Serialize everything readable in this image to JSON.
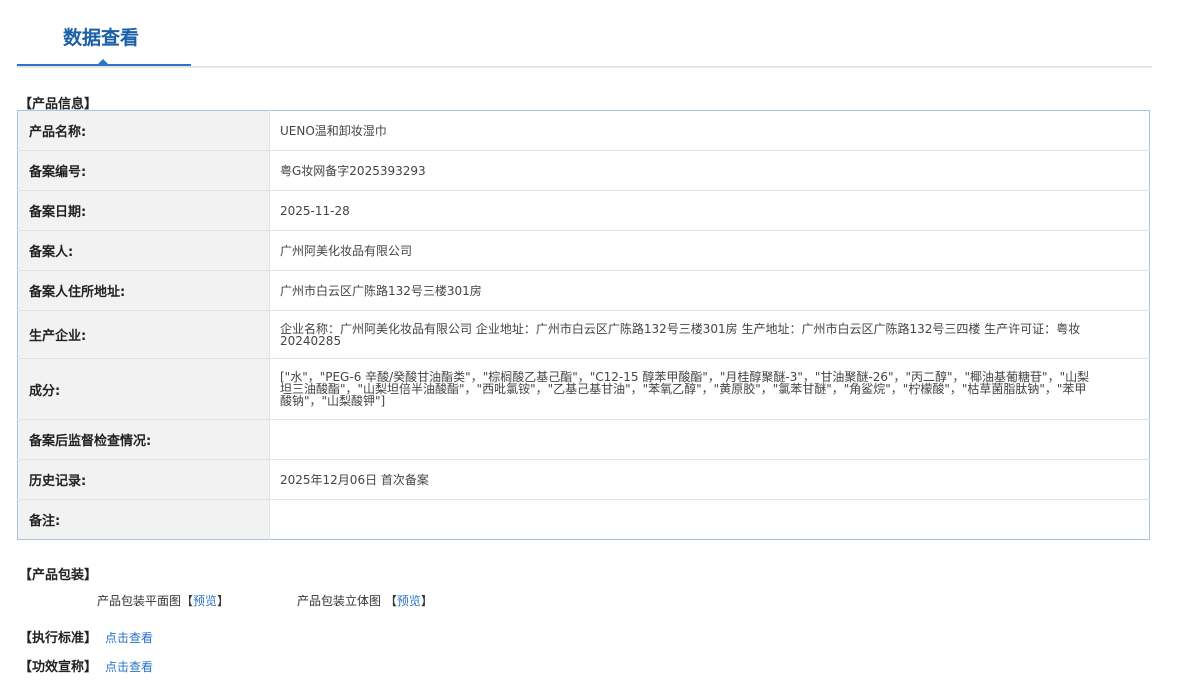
{
  "tab": {
    "title": "数据查看"
  },
  "product_info": {
    "section_title": "【产品信息】",
    "rows": [
      {
        "label": "产品名称:",
        "value": "UENO温和卸妆湿巾"
      },
      {
        "label": "备案编号:",
        "value": "粤G妆网备字2025393293"
      },
      {
        "label": "备案日期:",
        "value": "2025-11-28"
      },
      {
        "label": "备案人:",
        "value": "广州阿美化妆品有限公司"
      },
      {
        "label": "备案人住所地址:",
        "value": "广州市白云区广陈路132号三楼301房"
      },
      {
        "label": "生产企业:",
        "value": "企业名称：广州阿美化妆品有限公司 企业地址：广州市白云区广陈路132号三楼301房 生产地址：广州市白云区广陈路132号三四楼 生产许可证：粤妆20240285"
      },
      {
        "label": "成分:",
        "value": "[\"水\"，\"PEG-6 辛酸/癸酸甘油酯类\"，\"棕榈酸乙基己酯\"，\"C12-15 醇苯甲酸酯\"，\"月桂醇聚醚-3\"，\"甘油聚醚-26\"，\"丙二醇\"，\"椰油基葡糖苷\"，\"山梨坦三油酸酯\"，\"山梨坦倍半油酸酯\"，\"西吡氯铵\"，\"乙基己基甘油\"，\"苯氧乙醇\"，\"黄原胶\"，\"氯苯甘醚\"，\"角鲨烷\"，\"柠檬酸\"，\"枯草菌脂肽钠\"，\"苯甲酸钠\"，\"山梨酸钾\"]"
      },
      {
        "label": "备案后监督检查情况:",
        "value": ""
      },
      {
        "label": "历史记录:",
        "value": "2025年12月06日 首次备案"
      },
      {
        "label": "备注:",
        "value": ""
      }
    ]
  },
  "packaging": {
    "section_title": "【产品包装】",
    "flat_label": "产品包装平面图",
    "flat_link": "预览",
    "stereo_label": "产品包装立体图",
    "stereo_link": "预览",
    "bracket_open": "【",
    "bracket_close": "】"
  },
  "standard": {
    "section_title": "【执行标准】",
    "link": "点击查看"
  },
  "efficacy": {
    "section_title": "【功效宣称】",
    "link": "点击查看"
  }
}
